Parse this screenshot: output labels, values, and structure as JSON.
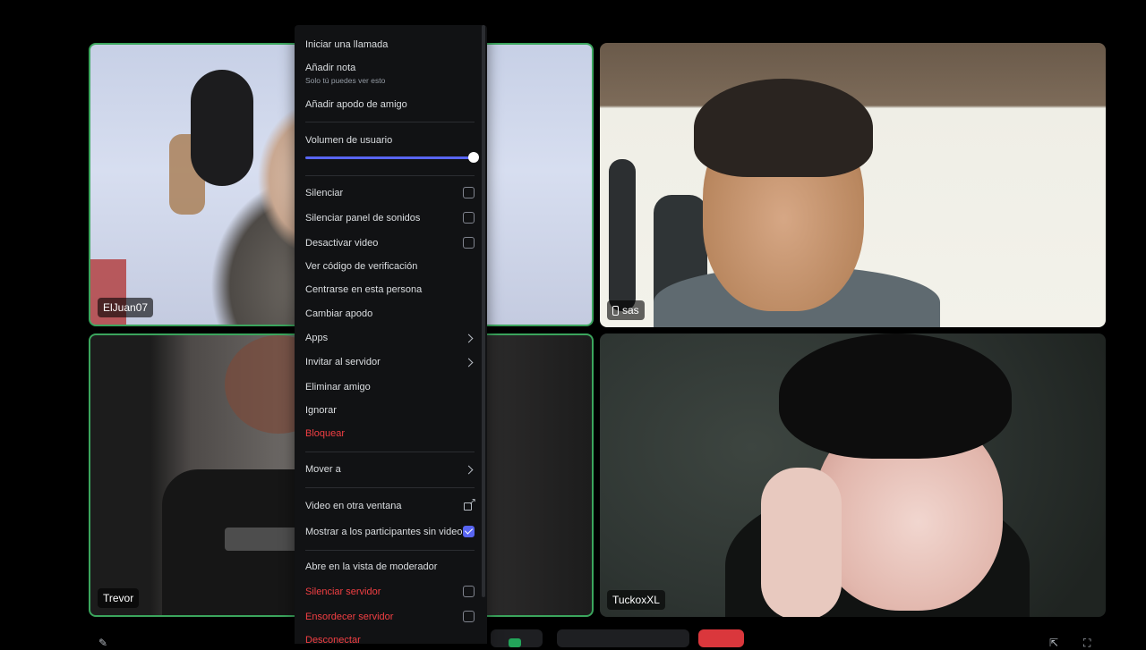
{
  "participants": [
    {
      "name": "ElJuan07",
      "speaking": true
    },
    {
      "name": "sas",
      "device": "phone-icon"
    },
    {
      "name": "Trevor",
      "speaking": true
    },
    {
      "name": "TuckoxXL"
    }
  ],
  "context_menu": {
    "start_call": "Iniciar una llamada",
    "add_note": "Añadir nota",
    "add_note_sub": "Solo tú puedes ver esto",
    "add_friend_nickname": "Añadir apodo de amigo",
    "user_volume": "Volumen de usuario",
    "user_volume_value": 1.0,
    "mute": "Silenciar",
    "mute_soundboard": "Silenciar panel de sonidos",
    "disable_video": "Desactivar video",
    "view_verification": "Ver código de verificación",
    "focus_person": "Centrarse en esta persona",
    "change_nickname": "Cambiar apodo",
    "apps": "Apps",
    "invite_server": "Invitar al servidor",
    "remove_friend": "Eliminar amigo",
    "ignore": "Ignorar",
    "block": "Bloquear",
    "move_to": "Mover a",
    "video_popout": "Video en otra ventana",
    "show_non_video": "Mostrar a los participantes sin video",
    "show_non_video_checked": true,
    "moderator_view": "Abre en la vista de moderador",
    "server_mute": "Silenciar servidor",
    "server_deafen": "Ensordecer servidor",
    "disconnect": "Desconectar"
  },
  "colors": {
    "speaking_border": "#3ba55d",
    "danger": "#f23f43",
    "accent": "#5865f2"
  }
}
